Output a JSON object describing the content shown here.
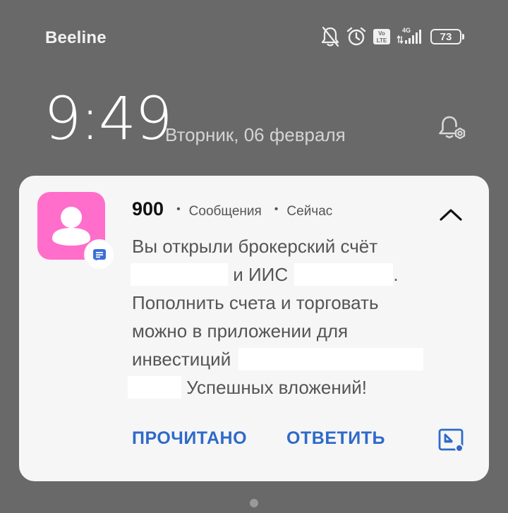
{
  "status_bar": {
    "carrier": "Beeline",
    "network": "4G",
    "volte": "Vo LTE",
    "battery": "73",
    "icons": [
      "bell-muted-icon",
      "alarm-clock-icon",
      "volte-icon",
      "signal-icon",
      "battery-icon"
    ]
  },
  "lockscreen": {
    "time": "9:49",
    "date": "Вторник, 06 февраля",
    "alarm_settings_icon": "alarm-settings-icon"
  },
  "notification": {
    "sender": "900",
    "app": "Сообщения",
    "when": "Сейчас",
    "avatar_color": "#ff6ecb",
    "lines": {
      "l1": "Вы открыли брокерский счёт",
      "l2a": "и ИИС",
      "l2b": ".",
      "l3": "Пополнить счета и торговать",
      "l4": "можно в приложении для",
      "l5": "инвестиций",
      "l6": "Успешных вложений!"
    },
    "actions": {
      "read": "ПРОЧИТАНО",
      "reply": "ОТВЕТИТЬ"
    },
    "accent": "#2e6ac9"
  }
}
